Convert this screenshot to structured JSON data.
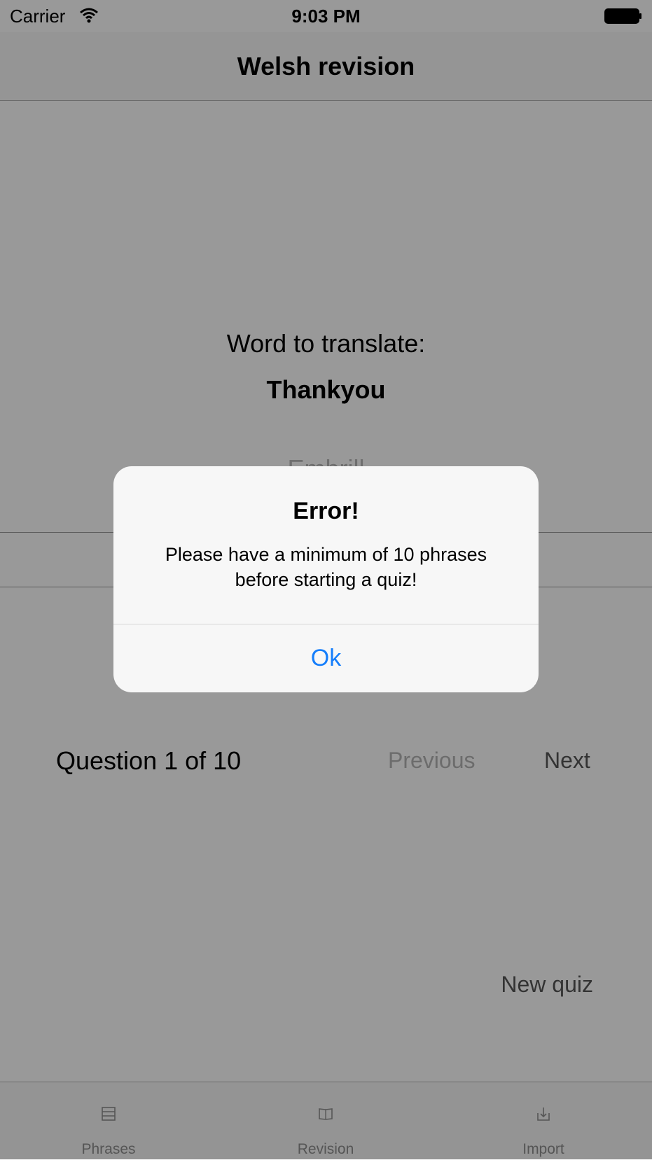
{
  "status_bar": {
    "carrier": "Carrier",
    "time": "9:03 PM",
    "wifi_icon": "wifi-icon",
    "battery_icon": "battery-icon"
  },
  "nav": {
    "title": "Welsh revision"
  },
  "quiz": {
    "word_label": "Word to translate:",
    "word": "Thankyou",
    "answer_value": "",
    "answer_placeholder": "Embrill",
    "question_counter": "Question 1 of 10",
    "previous_label": "Previous",
    "next_label": "Next",
    "new_quiz_label": "New quiz"
  },
  "tabs": [
    {
      "label": "Phrases",
      "icon": "list-icon"
    },
    {
      "label": "Revision",
      "icon": "book-icon"
    },
    {
      "label": "Import",
      "icon": "import-icon"
    }
  ],
  "alert": {
    "title": "Error!",
    "message_line1": "Please have a minimum of 10 phrases",
    "message_line2": "before starting a quiz!",
    "ok_label": "Ok"
  },
  "colors": {
    "accent": "#157efb",
    "overlay": "rgba(0,0,0,0.40)"
  }
}
